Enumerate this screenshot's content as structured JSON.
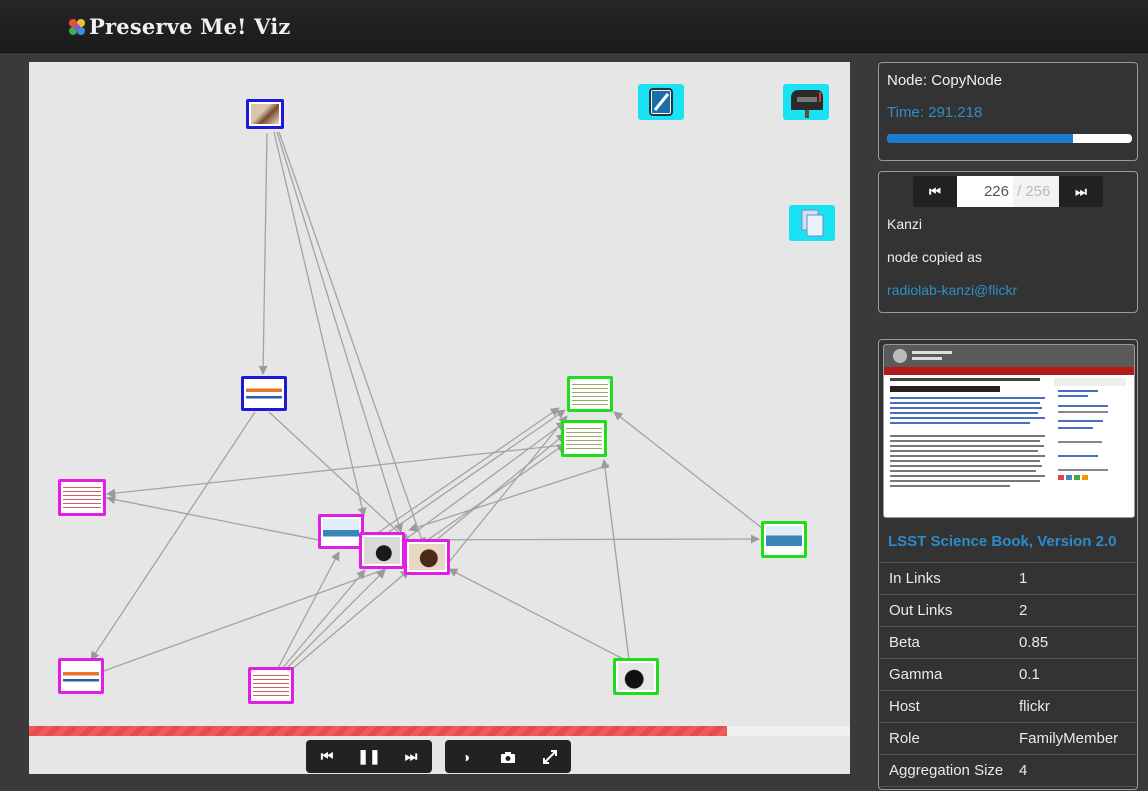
{
  "app": {
    "title": "Preserve Me! Viz"
  },
  "node_panel": {
    "title": "Node: CopyNode",
    "time": "Time: 291.218",
    "time_progress": 0.76
  },
  "event_panel": {
    "current": "226",
    "total": "/ 256",
    "name": "Kanzi",
    "action": "node copied as",
    "link": "radiolab-kanzi@flickr"
  },
  "detail_panel": {
    "document_title": "LSST Science Book, Version 2.0",
    "properties": [
      {
        "key": "In Links",
        "value": "1"
      },
      {
        "key": "Out Links",
        "value": "2"
      },
      {
        "key": "Beta",
        "value": "0.85"
      },
      {
        "key": "Gamma",
        "value": "0.1"
      },
      {
        "key": "Host",
        "value": "flickr"
      },
      {
        "key": "Role",
        "value": "FamilyMember"
      },
      {
        "key": "Aggregation Size",
        "value": "4"
      }
    ]
  },
  "playback": {
    "progress": 0.85
  },
  "toolbar_icons": [
    "notepad-icon",
    "mailbox-icon",
    "copy-documents-icon"
  ],
  "controls": [
    "skip-back-icon",
    "pause-icon",
    "skip-forward-icon",
    "contrast-icon",
    "camera-icon",
    "expand-icon"
  ],
  "colors": {
    "blue_node": "#1d19d6",
    "magenta_node": "#e11ee6",
    "green_node": "#1fdc1c",
    "accent": "#2f8ec8",
    "tool_bg": "#19e3f2"
  }
}
